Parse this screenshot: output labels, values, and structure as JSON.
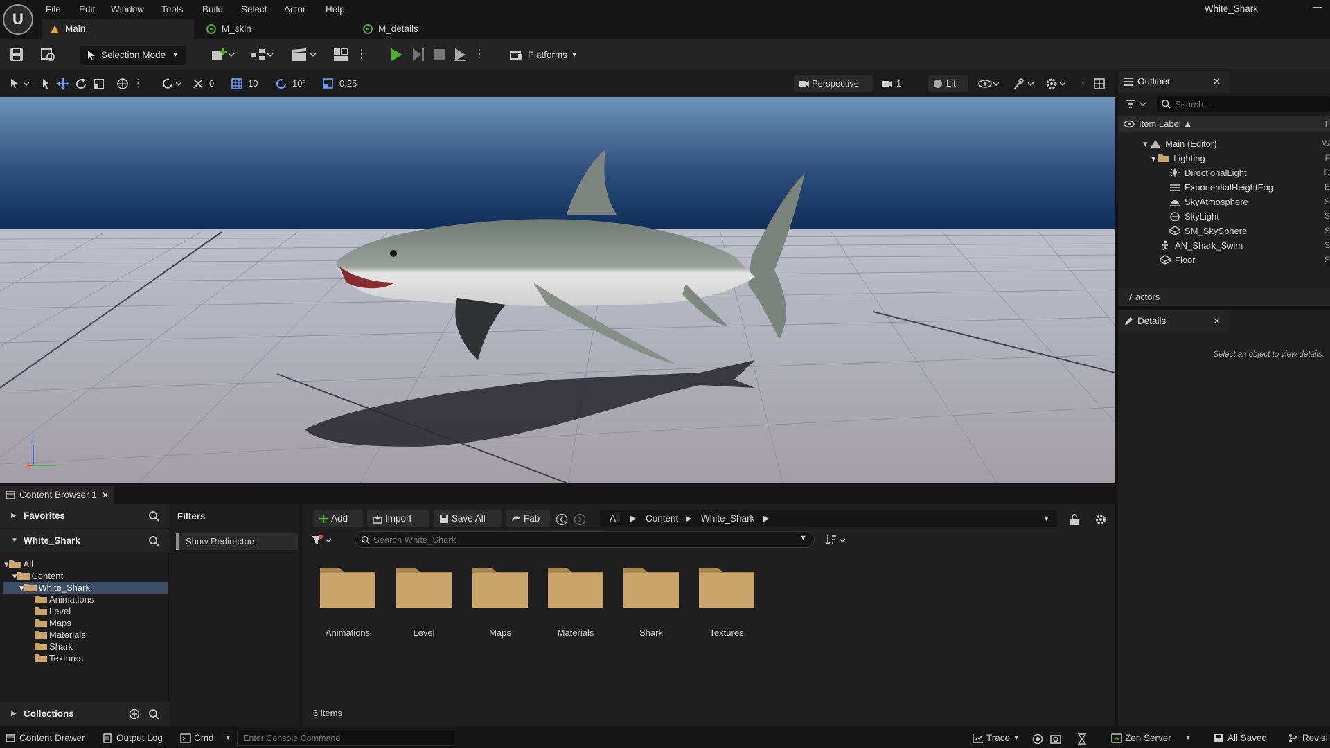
{
  "menu": [
    "File",
    "Edit",
    "Window",
    "Tools",
    "Build",
    "Select",
    "Actor",
    "Help"
  ],
  "project_name": "White_Shark",
  "logo_text": "U",
  "tabs": [
    {
      "label": "Main",
      "icon": "level-icon",
      "active": true
    },
    {
      "label": "M_skin",
      "icon": "material-icon",
      "active": false
    },
    {
      "label": "M_details",
      "icon": "material-icon",
      "active": false
    }
  ],
  "toolbar": {
    "selection_mode": "Selection Mode",
    "platforms": "Platforms"
  },
  "viewport": {
    "snap_translate": "0",
    "grid_size": "10",
    "rotation_snap": "10°",
    "scale_snap": "0,25",
    "view_mode": "Perspective",
    "camera_speed": "1",
    "lighting": "Lit",
    "axis_z": "Z",
    "axis_x": "X",
    "axis_y": "Y"
  },
  "content_browser": {
    "tab_label": "Content Browser 1",
    "favorites": "Favorites",
    "project_section": "White_Shark",
    "collections": "Collections",
    "tree": [
      "All",
      "Content",
      "White_Shark",
      "Animations",
      "Level",
      "Maps",
      "Materials",
      "Shark",
      "Textures"
    ],
    "filters_title": "Filters",
    "show_redirectors": "Show Redirectors",
    "buttons": {
      "add": "Add",
      "import": "Import",
      "save_all": "Save All",
      "fab": "Fab"
    },
    "breadcrumb": [
      "All",
      "Content",
      "White_Shark"
    ],
    "search_placeholder": "Search White_Shark",
    "assets": [
      "Animations",
      "Level",
      "Maps",
      "Materials",
      "Shark",
      "Textures"
    ],
    "items_count": "6 items"
  },
  "outliner": {
    "title": "Outliner",
    "search_placeholder": "Search...",
    "column_label": "Item Label ▲",
    "rows": [
      {
        "label": "Main (Editor)",
        "icon": "level-icon",
        "type_initial": "W"
      },
      {
        "label": "Lighting",
        "icon": "folder-icon",
        "type_initial": "F"
      },
      {
        "label": "DirectionalLight",
        "icon": "sun-icon",
        "type_initial": "D"
      },
      {
        "label": "ExponentialHeightFog",
        "icon": "fog-icon",
        "type_initial": "E"
      },
      {
        "label": "SkyAtmosphere",
        "icon": "atmosphere-icon",
        "type_initial": "S"
      },
      {
        "label": "SkyLight",
        "icon": "skylight-icon",
        "type_initial": "S"
      },
      {
        "label": "SM_SkySphere",
        "icon": "mesh-icon",
        "type_initial": "S"
      },
      {
        "label": "AN_Shark_Swim",
        "icon": "skeletal-icon",
        "type_initial": "S"
      },
      {
        "label": "Floor",
        "icon": "mesh-icon",
        "type_initial": "S"
      }
    ],
    "footer": "7 actors",
    "type_col": "T"
  },
  "details": {
    "title": "Details",
    "empty_message": "Select an object to view details."
  },
  "statusbar": {
    "content_drawer": "Content Drawer",
    "output_log": "Output Log",
    "cmd": "Cmd",
    "console_placeholder": "Enter Console Command",
    "trace": "Trace",
    "zen_server": "Zen Server",
    "all_saved": "All Saved",
    "revision": "Revisi"
  },
  "colors": {
    "accent_blue": "#3c4d66",
    "play_green": "#4fb02a",
    "folder": "#c9a46b",
    "sky_top": "#6f93b8",
    "floor": "#aeb2bb"
  }
}
